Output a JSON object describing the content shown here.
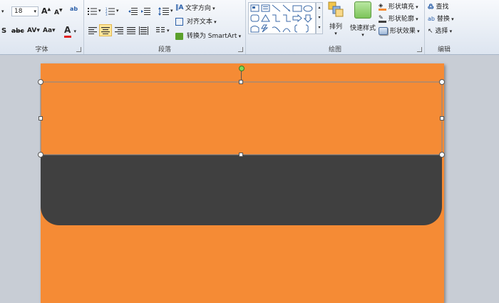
{
  "font_group": {
    "label": "字体",
    "size_value": "18",
    "grow_label": "A",
    "shrink_label": "A",
    "strike_label": "abc",
    "spacing_label": "AV",
    "case_label": "Aa",
    "color_label": "A",
    "bold_label": "S"
  },
  "paragraph_group": {
    "label": "段落",
    "text_direction": "文字方向",
    "align_text": "对齐文本",
    "convert_smartart": "转换为 SmartArt"
  },
  "drawing_group": {
    "label": "绘图",
    "arrange": "排列",
    "quick_styles": "快速样式",
    "shape_fill": "形状填充",
    "shape_outline": "形状轮廓",
    "shape_effects": "形状效果"
  },
  "editing_group": {
    "label": "编辑",
    "find": "查找",
    "replace": "替换",
    "select": "选择"
  },
  "colors": {
    "slide_orange": "#f58b35",
    "dark_shape": "#404040",
    "font_color_red": "#e02020",
    "rotation_handle_green": "#7ed957"
  }
}
